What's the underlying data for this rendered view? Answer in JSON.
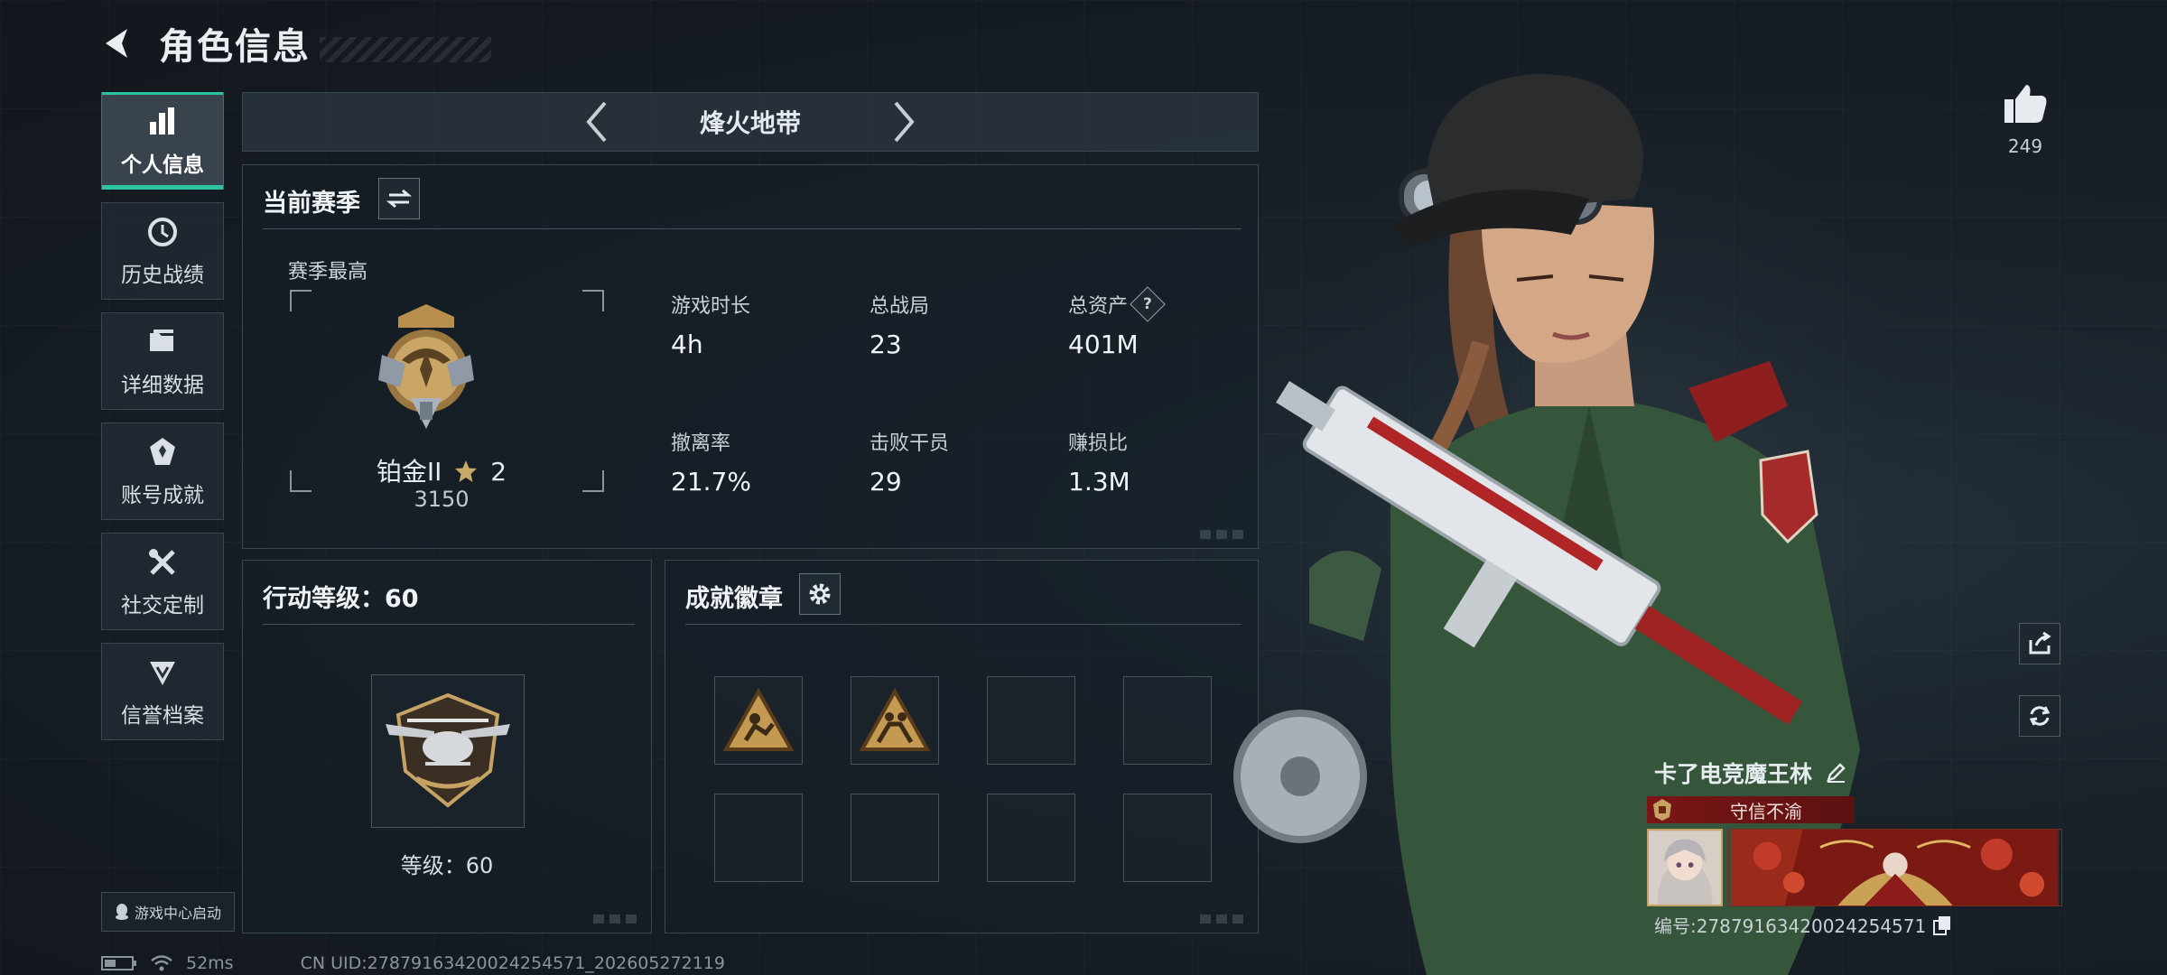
{
  "header": {
    "title": "角色信息"
  },
  "sidebar": {
    "items": [
      {
        "label": "个人信息",
        "icon": "bar-chart-icon",
        "active": true
      },
      {
        "label": "历史战绩",
        "icon": "history-clock-icon"
      },
      {
        "label": "详细数据",
        "icon": "folder-icon"
      },
      {
        "label": "账号成就",
        "icon": "achievement-icon"
      },
      {
        "label": "社交定制",
        "icon": "tools-icon"
      },
      {
        "label": "信誉档案",
        "icon": "reputation-icon"
      }
    ],
    "launch_label": "游戏中心启动"
  },
  "mode": {
    "title": "烽火地带"
  },
  "season": {
    "title": "当前赛季",
    "best_label": "赛季最高",
    "rank_name": "铂金II",
    "rank_stars": "2",
    "rank_score": "3150",
    "stats": [
      {
        "label": "游戏时长",
        "value": "4h"
      },
      {
        "label": "总战局",
        "value": "23"
      },
      {
        "label": "总资产",
        "value": "401M",
        "help": "?"
      },
      {
        "label": "撤离率",
        "value": "21.7%"
      },
      {
        "label": "击败干员",
        "value": "29"
      },
      {
        "label": "赚损比",
        "value": "1.3M"
      }
    ]
  },
  "action_level": {
    "title": "行动等级：60",
    "caption": "等级：60"
  },
  "badges": {
    "title": "成就徽章"
  },
  "likes": {
    "count": "249"
  },
  "player": {
    "name": "卡了电竞魔王林",
    "title": "守信不渝",
    "id_text": "编号:2787916342002425457​1"
  },
  "status": {
    "ping": "52ms",
    "uid": "CN UID:27879163420024254571_202605272119"
  },
  "colors": {
    "accent": "#2cc3a2",
    "title_red": "#7a1616",
    "gold": "#c6a265"
  }
}
